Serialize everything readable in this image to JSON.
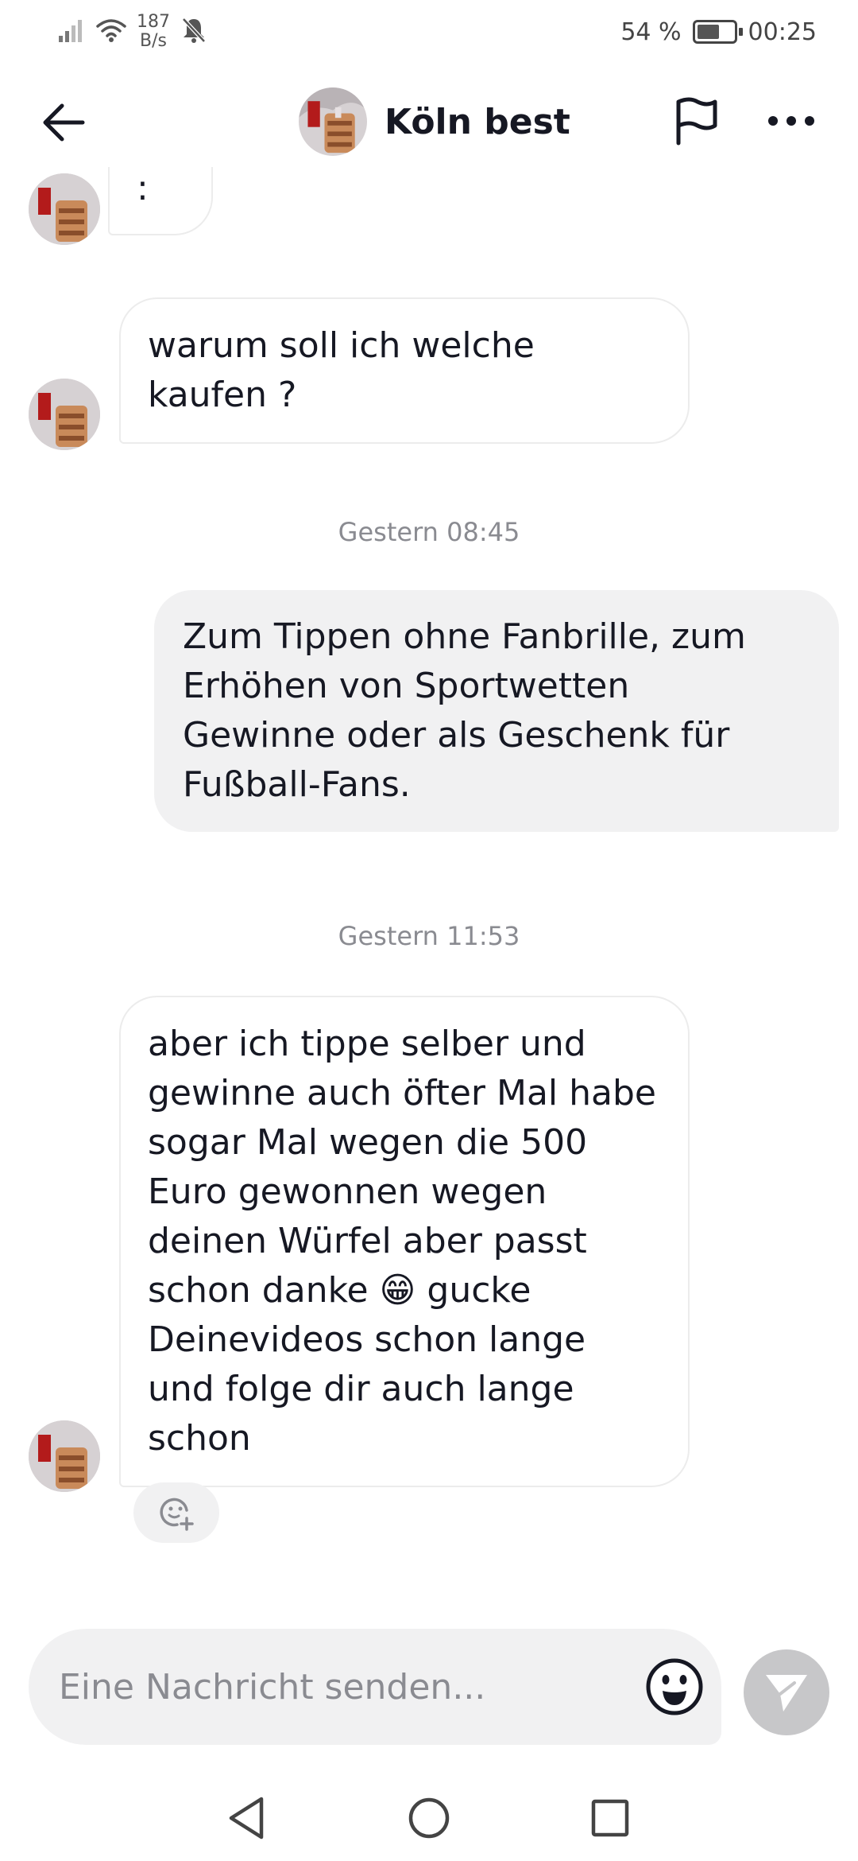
{
  "status_bar": {
    "network_speed_value": "187",
    "network_speed_unit": "B/s",
    "battery_percent": "54 %",
    "battery_level": 0.54,
    "time": "00:25",
    "icons": [
      "signal-icon",
      "wifi-icon",
      "mute-bell-icon",
      "battery-icon"
    ]
  },
  "header": {
    "contact_name": "Köln best",
    "icons": [
      "back-arrow-icon",
      "contact-avatar",
      "flag-icon",
      "more-dots-icon"
    ]
  },
  "messages": [
    {
      "direction": "in",
      "text": ":"
    },
    {
      "direction": "in",
      "text": "warum soll ich welche\nkaufen ?"
    },
    {
      "type": "timestamp",
      "text": "Gestern 08:45"
    },
    {
      "direction": "out",
      "text": "Zum Tippen ohne Fanbrille, zum\nErhöhen von Sportwetten\nGewinne oder als Geschenk für\nFußball-Fans."
    },
    {
      "type": "timestamp",
      "text": "Gestern 11:53"
    },
    {
      "direction": "in",
      "text": "aber ich tippe selber und\ngewinne auch öfter Mal habe\nsogar Mal wegen die 500\nEuro gewonnen wegen\ndeinen Würfel aber passt\nschon danke 😁 gucke\nDeinevideos schon lange\nund folge dir auch lange\nschon"
    }
  ],
  "composer": {
    "placeholder": "Eine Nachricht senden..."
  },
  "colors": {
    "incoming_bubble": "#ffffff",
    "outgoing_bubble": "#f1f1f2",
    "timestamp": "#8a8b91",
    "send_button": "#c7c7c9"
  }
}
